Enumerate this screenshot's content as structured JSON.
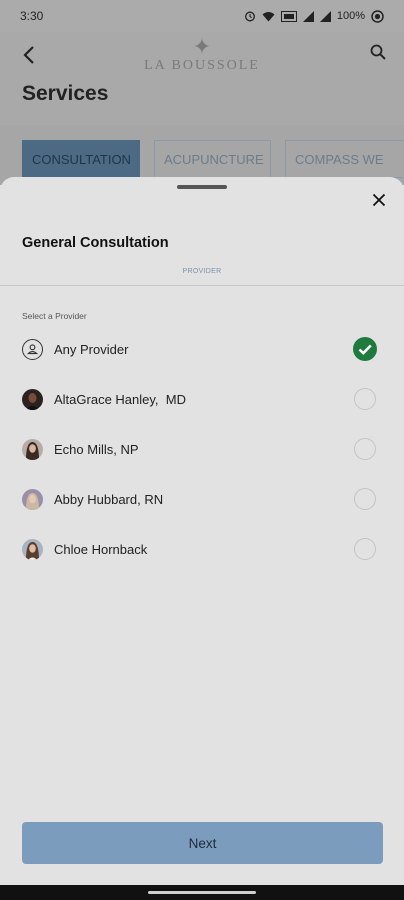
{
  "status_bar": {
    "time": "3:30",
    "battery": "100%",
    "icons": [
      "alarm-icon",
      "wifi-icon",
      "data-icon",
      "signal-icon",
      "signal-icon",
      "battery-icon",
      "circle-icon"
    ]
  },
  "app": {
    "logo_text": "LA BOUSSOLE",
    "page_title": "Services",
    "tabs": [
      {
        "label": "CONSULTATION",
        "active": true
      },
      {
        "label": "ACUPUNCTURE",
        "active": false
      },
      {
        "label": "COMPASS WE",
        "active": false
      }
    ]
  },
  "sheet": {
    "title": "General Consultation",
    "step": "PROVIDER",
    "section_label": "Select a Provider",
    "providers": [
      {
        "name": "Any Provider",
        "selected": true,
        "avatar": "user-icon"
      },
      {
        "name": "AltaGrace Hanley,  MD",
        "selected": false,
        "avatar": "photo"
      },
      {
        "name": "Echo Mills, NP",
        "selected": false,
        "avatar": "photo"
      },
      {
        "name": "Abby Hubbard, RN",
        "selected": false,
        "avatar": "photo"
      },
      {
        "name": "Chloe Hornback",
        "selected": false,
        "avatar": "photo"
      }
    ],
    "next_label": "Next"
  },
  "colors": {
    "accent": "#7b9cbd",
    "selected": "#1f7a3e",
    "active_tab": "#4d6a84"
  }
}
